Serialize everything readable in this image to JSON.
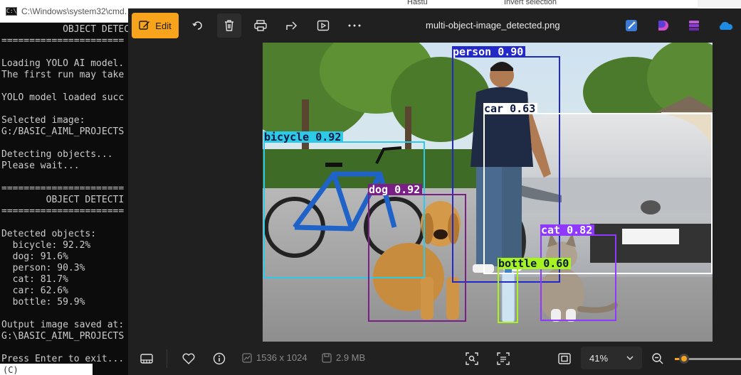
{
  "cmd": {
    "title": "C:\\Windows\\system32\\cmd.",
    "lines": [
      "           OBJECT DETEC",
      "======================",
      "",
      "Loading YOLO AI model.",
      "The first run may take",
      "",
      "YOLO model loaded succ",
      "",
      "Selected image:",
      "G:/BASIC_AIML_PROJECTS",
      "",
      "Detecting objects...",
      "Please wait...",
      "",
      "======================",
      "        OBJECT DETECTI",
      "======================",
      "",
      "Detected objects:",
      "  bicycle: 92.2%",
      "  dog: 91.6%",
      "  person: 90.3%",
      "  cat: 81.7%",
      "  car: 62.6%",
      "  bottle: 59.9%",
      "",
      "Output image saved at:",
      "G:\\BASIC_AIML_PROJECTS",
      "",
      "Press Enter to exit..."
    ],
    "prompt_fragment": "(C)"
  },
  "behind_window": {
    "tab_a": "Hastu",
    "tab_b": "Invert selection"
  },
  "viewer": {
    "toolbar": {
      "edit_label": "Edit",
      "file_name": "multi-object-image_detected.png"
    },
    "detections": [
      {
        "label": "person 0.90",
        "color": "#2328c8"
      },
      {
        "label": "car 0.63",
        "color": "#ffffff"
      },
      {
        "label": "bicycle 0.92",
        "color": "#2ec9e8"
      },
      {
        "label": "dog 0.92",
        "color": "#7a1f86"
      },
      {
        "label": "cat 0.82",
        "color": "#8f38ff"
      },
      {
        "label": "bottle 0.60",
        "color": "#a7f321"
      }
    ],
    "bottom": {
      "dimensions": "1536 x 1024",
      "file_size": "2.9 MB",
      "zoom": "41%",
      "zoom_level": 0.41
    },
    "colors": {
      "accent": "#f7a31c",
      "background": "#202020"
    }
  }
}
